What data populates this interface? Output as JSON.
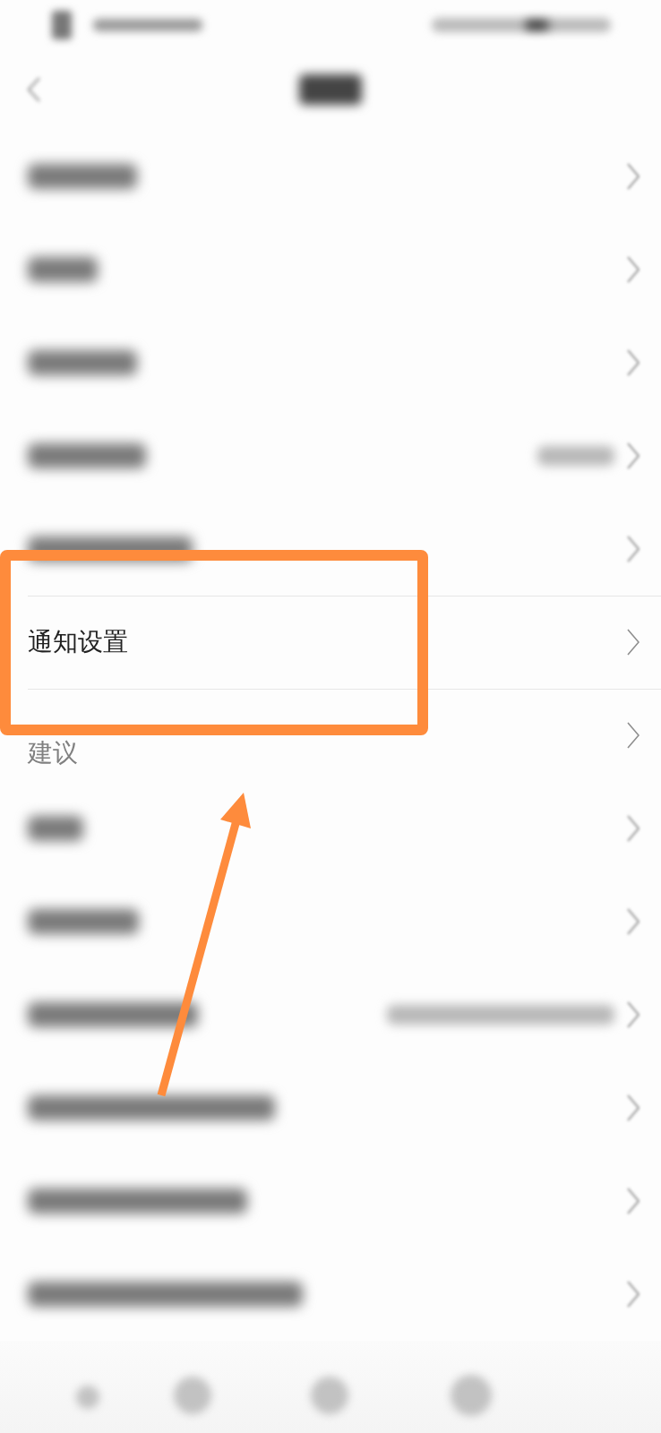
{
  "rows": [
    {
      "kind": "blurred",
      "highlighted": false
    },
    {
      "kind": "blurred",
      "highlighted": false
    },
    {
      "kind": "blurred",
      "highlighted": false
    },
    {
      "kind": "blurred_value",
      "highlighted": false
    },
    {
      "kind": "blurred",
      "highlighted": false
    },
    {
      "kind": "text",
      "label": "通知设置",
      "faded": false,
      "highlighted": true
    },
    {
      "kind": "text",
      "label": "建议",
      "faded": true,
      "highlighted": false
    },
    {
      "kind": "blurred",
      "highlighted": false
    },
    {
      "kind": "blurred",
      "highlighted": false
    },
    {
      "kind": "blurred_value",
      "highlighted": false
    },
    {
      "kind": "blurred",
      "highlighted": false
    },
    {
      "kind": "blurred",
      "highlighted": false
    },
    {
      "kind": "blurred",
      "highlighted": false
    }
  ]
}
